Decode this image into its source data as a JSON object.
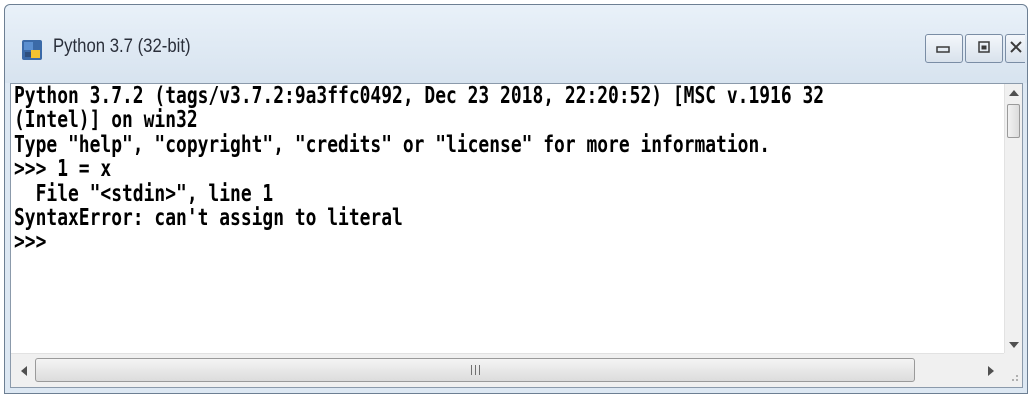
{
  "window": {
    "title": "Python 3.7 (32-bit)",
    "icon": "python-icon",
    "controls": [
      "minimize-icon",
      "maximize-icon",
      "close-icon"
    ]
  },
  "console": {
    "lines": [
      "Python 3.7.2 (tags/v3.7.2:9a3ffc0492, Dec 23 2018, 22:20:52) [MSC v.1916 32",
      "(Intel)] on win32",
      "Type \"help\", \"copyright\", \"credits\" or \"license\" for more information.",
      ">>> 1 = x",
      "  File \"<stdin>\", line 1",
      "SyntaxError: can't assign to literal",
      ">>>"
    ]
  }
}
